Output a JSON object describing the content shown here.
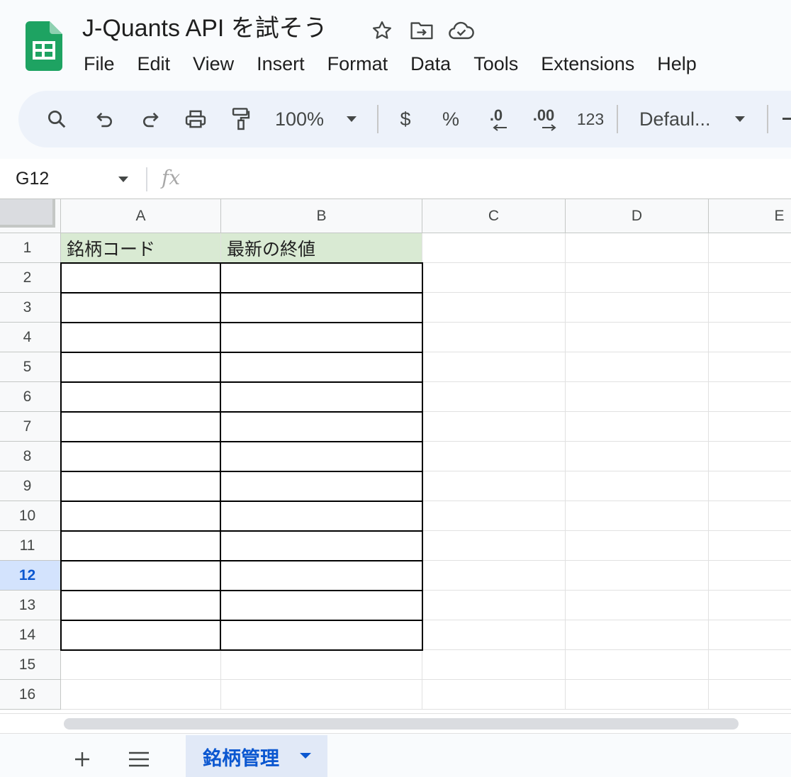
{
  "app": {
    "doc_title": "J-Quants API を試そう",
    "colors": {
      "sheets_green": "#1ea362",
      "header_fill": "#d9ead3",
      "active_blue": "#0b57d0",
      "selected_header": "#d3e3fd"
    }
  },
  "title_icons": [
    "star-icon",
    "move-to-folder-icon",
    "cloud-saved-icon"
  ],
  "menu": [
    "File",
    "Edit",
    "View",
    "Insert",
    "Format",
    "Data",
    "Tools",
    "Extensions",
    "Help"
  ],
  "toolbar": {
    "zoom": "100%",
    "currency": "$",
    "percent": "%",
    "decrease_decimal": ".0",
    "increase_decimal": ".00",
    "number_format": "123",
    "font": "Defaul..."
  },
  "formula_bar": {
    "name_box": "G12",
    "fx": "fx",
    "formula": ""
  },
  "grid": {
    "columns": [
      "A",
      "B",
      "C",
      "D",
      "E"
    ],
    "rows": [
      "1",
      "2",
      "3",
      "4",
      "5",
      "6",
      "7",
      "8",
      "9",
      "10",
      "11",
      "12",
      "13",
      "14",
      "15",
      "16"
    ],
    "active_row": "12",
    "header_cells": {
      "A1": "銘柄コード",
      "B1": "最新の終値"
    }
  },
  "sheets": {
    "active_tab": "銘柄管理"
  }
}
